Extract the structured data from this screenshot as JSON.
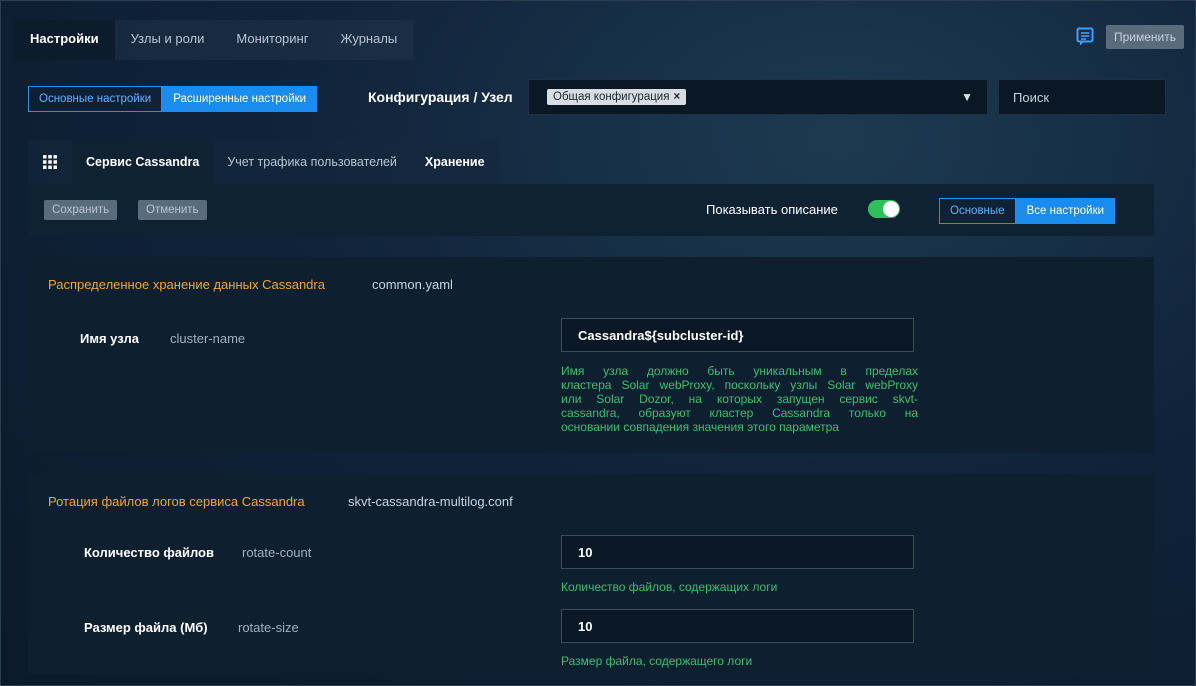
{
  "topnav": {
    "tabs": [
      {
        "label": "Настройки",
        "active": true
      },
      {
        "label": "Узлы и роли"
      },
      {
        "label": "Мониторинг"
      },
      {
        "label": "Журналы"
      }
    ],
    "apply_label": "Применить",
    "chat_icon": "message-icon"
  },
  "settings": {
    "basic_label": "Основные настройки",
    "advanced_label": "Расширенные настройки",
    "config_title": "Конфигурация / Узел",
    "config_chip": "Общая конфигурация",
    "chip_close": "×",
    "dropdown_arrow": "▼",
    "search_placeholder": "Поиск"
  },
  "subtabs": {
    "items": [
      {
        "label": "Сервис Cassandra",
        "active": true
      },
      {
        "label": "Учет трафика пользователей"
      },
      {
        "label": "Хранение"
      }
    ]
  },
  "toolbar": {
    "save_label": "Сохранить",
    "cancel_label": "Отменить",
    "show_desc_label": "Показывать описание",
    "show_desc_on": true,
    "basic_label": "Основные",
    "all_label": "Все настройки"
  },
  "panels": [
    {
      "title": "Распределенное хранение данных Cassandra",
      "file": "common.yaml",
      "params": [
        {
          "label": "Имя узла",
          "key": "cluster-name",
          "value": "Cassandra${subcluster-id}",
          "hint_lines": [
            "Имя узла должно быть уникальным в пределах",
            "кластера Solar webProxy, поскольку узлы Solar webProxy",
            "или Solar Dozor, на которых запущен сервис skvt-",
            "cassandra, образуют кластер Cassandra только на",
            "основании совпадения значения этого параметра"
          ]
        }
      ]
    },
    {
      "title": "Ротация файлов логов сервиса Cassandra",
      "file": "skvt-cassandra-multilog.conf",
      "params": [
        {
          "label": "Количество файлов",
          "key": "rotate-count",
          "value": "10",
          "hint": "Количество файлов, содержащих логи"
        },
        {
          "label": "Размер файла (Мб)",
          "key": "rotate-size",
          "value": "10",
          "hint": "Размер файла, содержащего логи"
        }
      ]
    }
  ],
  "colors": {
    "accent": "#1a8cf0",
    "section_title": "#f5a623",
    "hint": "#36c16e",
    "toggle_on": "#2ec15b"
  }
}
